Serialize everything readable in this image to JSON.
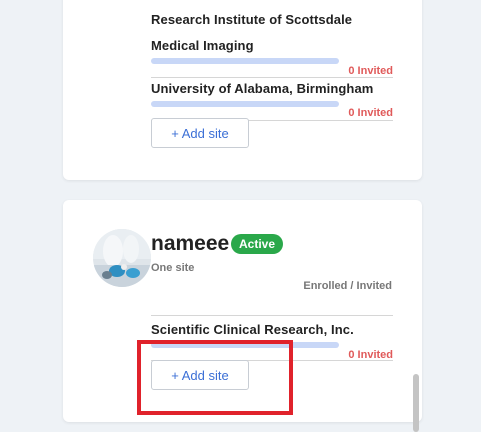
{
  "top_card": {
    "sites": [
      {
        "name": "Research Institute of Scottsdale",
        "status": ""
      },
      {
        "name": "Medical Imaging",
        "status": "0 Invited"
      },
      {
        "name": "University of Alabama, Birmingham",
        "status": "0 Invited"
      }
    ],
    "add_site_label": "+ Add site"
  },
  "user_card": {
    "name": "nameee",
    "badge": "Active",
    "site_count": "One site",
    "column_header": "Enrolled / Invited",
    "sites": [
      {
        "name": "Scientific Clinical Research, Inc.",
        "status": "0 Invited"
      }
    ],
    "add_site_label": "+ Add site"
  },
  "colors": {
    "accent": "#3b6fd6",
    "active": "#2aa84a",
    "invited": "#e05a5a",
    "highlight": "#e0222b"
  }
}
